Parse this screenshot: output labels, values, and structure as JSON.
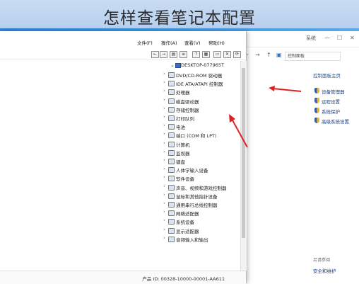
{
  "banner": {
    "title": "怎样查看笔记本配置"
  },
  "device_manager": {
    "menu": [
      {
        "label": "文件(F)"
      },
      {
        "label": "操作(A)"
      },
      {
        "label": "查看(V)"
      },
      {
        "label": "帮助(H)"
      }
    ],
    "tree_root": "DESKTOP-077965T",
    "devices": [
      {
        "label": "DVD/CD-ROM 驱动器"
      },
      {
        "label": "IDE ATA/ATAPI 控制器"
      },
      {
        "label": "处理器"
      },
      {
        "label": "磁盘驱动器"
      },
      {
        "label": "存储控制器"
      },
      {
        "label": "打印队列"
      },
      {
        "label": "电池"
      },
      {
        "label": "端口 (COM 和 LPT)"
      },
      {
        "label": "计算机"
      },
      {
        "label": "监视器"
      },
      {
        "label": "键盘"
      },
      {
        "label": "人体学输入设备"
      },
      {
        "label": "软件设备"
      },
      {
        "label": "声音、视频和游戏控制器"
      },
      {
        "label": "鼠标和其他指针设备"
      },
      {
        "label": "通用串行总线控制器"
      },
      {
        "label": "网络适配器"
      },
      {
        "label": "系统设备"
      },
      {
        "label": "显示适配器"
      },
      {
        "label": "音频输入和输出"
      }
    ],
    "product_id": "产品 ID: 00328-10000-00001-AA611"
  },
  "system_window": {
    "title": "系统",
    "breadcrumb": "控制面板",
    "home_link": "控制面板主页",
    "links": [
      {
        "label": "设备管理器"
      },
      {
        "label": "远程设置"
      },
      {
        "label": "系统保护"
      },
      {
        "label": "高级系统设置"
      }
    ],
    "see_also": "另请参阅",
    "security_link": "安全和维护"
  },
  "colors": {
    "banner": "#c9dcf3",
    "desktop": "#3a96e0",
    "arrow": "#e02020",
    "link": "#1a3e7a"
  }
}
